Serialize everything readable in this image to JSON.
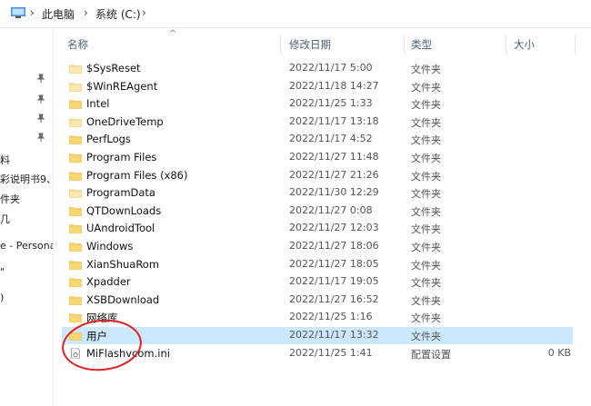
{
  "address_bar": {
    "icon": "this-pc-icon",
    "crumbs": [
      "此电脑",
      "系统 (C:)"
    ]
  },
  "sidebar": {
    "fragments": [
      "料",
      "彩说明书9、",
      "件夹",
      "几",
      "e - Persona",
      "\"",
      ")"
    ]
  },
  "columns": {
    "name": "名称",
    "modified": "修改日期",
    "type": "类型",
    "size": "大小"
  },
  "files": [
    {
      "name": "$SysReset",
      "date": "2022/11/17 5:00",
      "type": "文件夹",
      "size": "",
      "icon": "folder-icon",
      "faded": true
    },
    {
      "name": "$WinREAgent",
      "date": "2022/11/18 14:27",
      "type": "文件夹",
      "size": "",
      "icon": "folder-icon",
      "faded": true
    },
    {
      "name": "Intel",
      "date": "2022/11/25 1:33",
      "type": "文件夹",
      "size": "",
      "icon": "folder-icon",
      "faded": false
    },
    {
      "name": "OneDriveTemp",
      "date": "2022/11/17 13:18",
      "type": "文件夹",
      "size": "",
      "icon": "folder-icon",
      "faded": true
    },
    {
      "name": "PerfLogs",
      "date": "2022/11/17 4:52",
      "type": "文件夹",
      "size": "",
      "icon": "folder-icon",
      "faded": false
    },
    {
      "name": "Program Files",
      "date": "2022/11/27 11:48",
      "type": "文件夹",
      "size": "",
      "icon": "folder-icon",
      "faded": false
    },
    {
      "name": "Program Files (x86)",
      "date": "2022/11/27 21:26",
      "type": "文件夹",
      "size": "",
      "icon": "folder-icon",
      "faded": false
    },
    {
      "name": "ProgramData",
      "date": "2022/11/30 12:29",
      "type": "文件夹",
      "size": "",
      "icon": "folder-icon",
      "faded": true
    },
    {
      "name": "QTDownLoads",
      "date": "2022/11/27 0:08",
      "type": "文件夹",
      "size": "",
      "icon": "folder-icon",
      "faded": false
    },
    {
      "name": "UAndroidTool",
      "date": "2022/11/27 12:03",
      "type": "文件夹",
      "size": "",
      "icon": "folder-icon",
      "faded": false
    },
    {
      "name": "Windows",
      "date": "2022/11/27 18:06",
      "type": "文件夹",
      "size": "",
      "icon": "folder-icon",
      "faded": false
    },
    {
      "name": "XianShuaRom",
      "date": "2022/11/27 18:05",
      "type": "文件夹",
      "size": "",
      "icon": "folder-icon",
      "faded": false
    },
    {
      "name": "Xpadder",
      "date": "2022/11/17 19:05",
      "type": "文件夹",
      "size": "",
      "icon": "folder-icon",
      "faded": false
    },
    {
      "name": "XSBDownload",
      "date": "2022/11/27 16:52",
      "type": "文件夹",
      "size": "",
      "icon": "folder-icon",
      "faded": false
    },
    {
      "name": "网络库",
      "date": "2022/11/25 1:16",
      "type": "文件夹",
      "size": "",
      "icon": "folder-icon",
      "faded": false
    },
    {
      "name": "用户",
      "date": "2022/11/17 13:32",
      "type": "文件夹",
      "size": "",
      "icon": "folder-icon",
      "faded": false,
      "selected": true
    },
    {
      "name": "MiFlashvcom.ini",
      "date": "2022/11/25 1:41",
      "type": "配置设置",
      "size": "0 KB",
      "icon": "ini-file-icon",
      "faded": false
    }
  ],
  "colors": {
    "folder": "#f8d775",
    "folder_faded": "#fbe8b0",
    "selection": "#cce8ff",
    "annotation_circle": "#e02020"
  }
}
